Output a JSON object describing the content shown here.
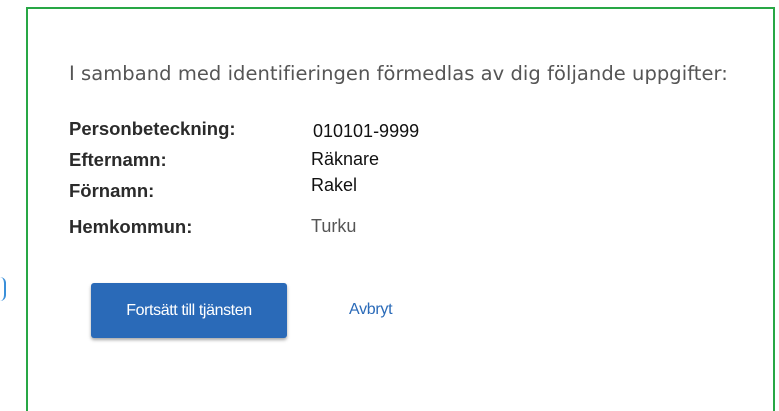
{
  "intro_text": "I samband med identifieringen förmedlas av dig följande uppgifter:",
  "fields": [
    {
      "label": "Personbeteckning:",
      "value": "010101-9999"
    },
    {
      "label": "Efternamn:",
      "value": "Räknare"
    },
    {
      "label": "Förnamn:",
      "value": "Rakel"
    },
    {
      "label": "Hemkommun:",
      "value": "Turku"
    }
  ],
  "actions": {
    "continue_label": "Fortsätt till tjänsten",
    "cancel_label": "Avbryt"
  },
  "colors": {
    "panel_border": "#28a745",
    "primary_button": "#2a6ab8",
    "link": "#2a6ab8"
  }
}
